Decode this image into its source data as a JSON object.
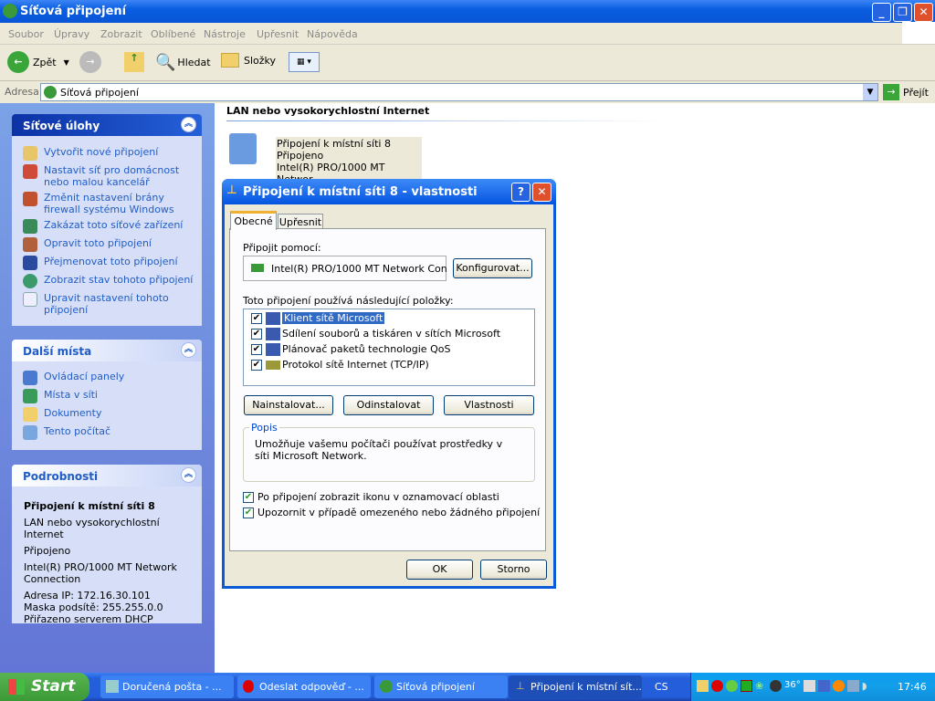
{
  "window": {
    "title": "Síťová připojení"
  },
  "menu": [
    "Soubor",
    "Úpravy",
    "Zobrazit",
    "Oblíbené",
    "Nástroje",
    "Upřesnit",
    "Nápověda"
  ],
  "toolbar": {
    "back": "Zpět",
    "search": "Hledat",
    "folders": "Složky"
  },
  "address": {
    "label": "Adresa",
    "value": "Síťová připojení",
    "go": "Přejít"
  },
  "sidebar": {
    "tasks": {
      "title": "Síťové úlohy",
      "items": [
        "Vytvořit nové připojení",
        "Nastavit síť pro domácnost nebo malou kancelář",
        "Změnit nastavení brány firewall systému Windows",
        "Zakázat toto síťové zařízení",
        "Opravit toto připojení",
        "Přejmenovat toto připojení",
        "Zobrazit stav tohoto připojení",
        "Upravit nastavení tohoto připojení"
      ]
    },
    "places": {
      "title": "Další místa",
      "items": [
        "Ovládací panely",
        "Místa v síti",
        "Dokumenty",
        "Tento počítač"
      ]
    },
    "details": {
      "title": "Podrobnosti",
      "name": "Připojení k místní síti 8",
      "type": "LAN nebo vysokorychlostní Internet",
      "status": "Připojeno",
      "device": "Intel(R) PRO/1000 MT Network Connection",
      "ip": "Adresa IP: 172.16.30.101",
      "mask": "Maska podsítě: 255.255.0.0",
      "dhcp": "Přiřazeno serverem DHCP"
    }
  },
  "content": {
    "group": "LAN nebo vysokorychlostní Internet",
    "connection": {
      "name": "Připojení k místní síti 8",
      "status": "Připojeno",
      "device": "Intel(R) PRO/1000 MT Networ..."
    }
  },
  "dialog": {
    "title": "Připojení k místní síti 8 - vlastnosti",
    "tabs": [
      "Obecné",
      "Upřesnit"
    ],
    "connect_using_label": "Připojit pomocí:",
    "adapter": "Intel(R) PRO/1000 MT Network Con",
    "configure": "Konfigurovat...",
    "items_label": "Toto připojení používá následující položky:",
    "items": [
      {
        "label": "Klient sítě Microsoft",
        "checked": true
      },
      {
        "label": "Sdílení souborů a tiskáren v sítích Microsoft",
        "checked": true
      },
      {
        "label": "Plánovač paketů technologie QoS",
        "checked": true
      },
      {
        "label": "Protokol sítě Internet (TCP/IP)",
        "checked": true
      }
    ],
    "install": "Nainstalovat...",
    "uninstall": "Odinstalovat",
    "properties": "Vlastnosti",
    "desc_title": "Popis",
    "desc": "Umožňuje vašemu počítači používat prostředky v síti Microsoft Network.",
    "opt1": "Po připojení zobrazit ikonu v oznamovací oblasti",
    "opt2": "Upozornit v případě omezeného nebo žádného připojení",
    "ok": "OK",
    "cancel": "Storno"
  },
  "taskbar": {
    "start": "Start",
    "tasks": [
      "Doručená pošta - ...",
      "Odeslat odpověď - ...",
      "Síťová připojení",
      "Připojení k místní sít..."
    ],
    "lang": "CS",
    "temp": "36°",
    "clock": "17:46"
  }
}
